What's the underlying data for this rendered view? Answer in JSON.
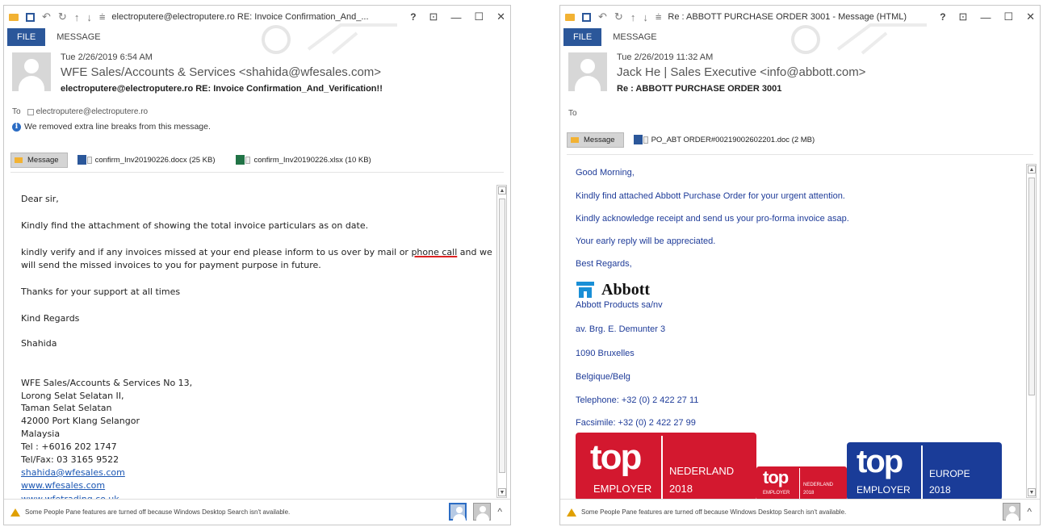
{
  "left": {
    "title": "electroputere@electroputere.ro RE: Invoice Confirmation_And_...",
    "tabs": {
      "file": "FILE",
      "message": "MESSAGE"
    },
    "header": {
      "date": "Tue 2/26/2019 6:54 AM",
      "from": "WFE Sales/Accounts & Services <shahida@wfesales.com>",
      "subject": "electroputere@electroputere.ro RE: Invoice Confirmation_And_Verification!!",
      "to_label": "To",
      "to_value": "electroputere@electroputere.ro",
      "notice": "We removed extra line breaks from this message."
    },
    "attachments": {
      "message_tab": "Message",
      "items": [
        "confirm_Inv20190226.docx (25 KB)",
        "confirm_Inv20190226.xlsx (10 KB)"
      ]
    },
    "body": {
      "l1": "Dear sir,",
      "l2": "Kindly find the attachment of showing the total invoice particulars as on date.",
      "l3a": "kindly verify and if any invoices missed at your end please inform to us over by mail or ",
      "l3b": "phone call",
      "l3c": " and we",
      "l4": "will send the missed invoices to you for payment purpose in future.",
      "l5": "Thanks for your support at all times",
      "l6": "Kind Regards",
      "l7": "Shahida",
      "sig": [
        "WFE Sales/Accounts & Services No 13,",
        "Lorong Selat Selatan II,",
        "Taman Selat Selatan",
        "42000 Port Klang Selangor",
        "Malaysia",
        "Tel : +6016 202 1747",
        "Tel/Fax: 03 3165 9522"
      ],
      "links": [
        "shahida@wfesales.com",
        "www.wfesales.com",
        "www.wfetrading.co.uk"
      ]
    },
    "status": "Some People Pane features are turned off because Windows Desktop Search isn't available."
  },
  "right": {
    "title": "Re : ABBOTT PURCHASE ORDER 3001 - Message (HTML)",
    "tabs": {
      "file": "FILE",
      "message": "MESSAGE"
    },
    "header": {
      "date": "Tue 2/26/2019 11:32 AM",
      "from": "Jack He | Sales Executive <info@abbott.com>",
      "subject": "Re : ABBOTT PURCHASE ORDER 3001",
      "to_label": "To"
    },
    "attachments": {
      "message_tab": "Message",
      "items": [
        "PO_ABT ORDER#00219002602201.doc (2 MB)"
      ]
    },
    "body": {
      "greeting": "Good Morning,",
      "l1": "Kindly find attached Abbott Purchase Order for your urgent attention.",
      "l2": "Kindly acknowledge receipt and send us your pro-forma invoice asap.",
      "l3": "Your early reply will be appreciated.",
      "l4": "Best Regards,",
      "logo_word": "Abbott",
      "company": "Abbott Products sa/nv",
      "addr1": "av. Brg. E. Demunter 3",
      "addr2": "1090 Bruxelles",
      "addr3": "Belgique/Belg",
      "tel": "Telephone: +32 (0) 2 422 27 11",
      "fax": "Facsimile: +32 (0) 2 422 27 99"
    },
    "banners": [
      {
        "top": "top",
        "sub": "EMPLOYER",
        "region": "NEDERLAND",
        "year": "2018",
        "color": "#d3182f"
      },
      {
        "top": "top",
        "sub": "EMPLOYER",
        "region": "NEDERLAND",
        "year": "2018",
        "color": "#d3182f"
      },
      {
        "top": "top",
        "sub": "EMPLOYER",
        "region": "EUROPE",
        "year": "2018",
        "color": "#1a3c98"
      }
    ],
    "status": "Some People Pane features are turned off because Windows Desktop Search isn't available."
  }
}
